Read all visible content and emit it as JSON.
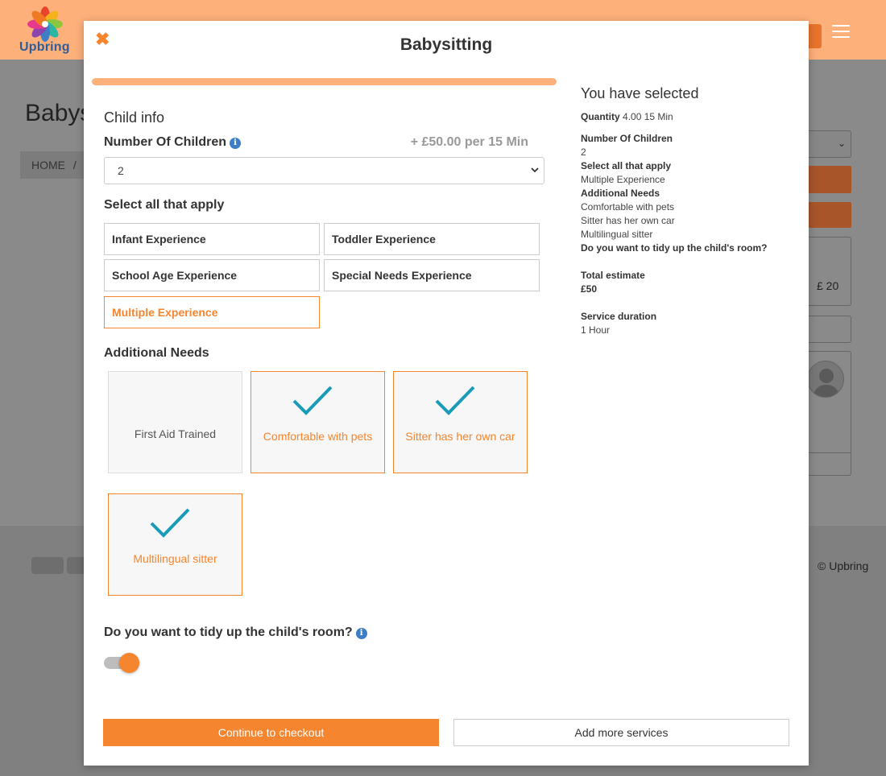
{
  "background": {
    "logo_text": "Upbring",
    "page_title": "Babys",
    "breadcrumb_home": "HOME",
    "breadcrumb_sep": "/",
    "price": "£ 20",
    "copyright": "© Upbring"
  },
  "modal": {
    "title": "Babysitting",
    "progress": 1.0,
    "section_heading": "Child info",
    "children": {
      "label": "Number Of Children",
      "price_note": "+ £50.00 per 15 Min",
      "value": "2"
    },
    "apply": {
      "heading": "Select all that apply",
      "options": [
        {
          "label": "Infant Experience",
          "selected": false
        },
        {
          "label": "Toddler Experience",
          "selected": false
        },
        {
          "label": "School Age Experience",
          "selected": false
        },
        {
          "label": "Special Needs Experience",
          "selected": false
        },
        {
          "label": "Multiple Experience",
          "selected": true
        }
      ]
    },
    "needs": {
      "heading": "Additional Needs",
      "items": [
        {
          "label": "First Aid Trained",
          "selected": false
        },
        {
          "label": "Comfortable with pets",
          "selected": true
        },
        {
          "label": "Sitter has her own car",
          "selected": true
        },
        {
          "label": "Multilingual sitter",
          "selected": true
        }
      ]
    },
    "tidy": {
      "label": "Do you want to tidy up the child's room?",
      "on": true
    },
    "buttons": {
      "checkout": "Continue to checkout",
      "more": "Add more services"
    },
    "summary": {
      "title": "You have selected",
      "quantity_label": "Quantity",
      "quantity_value": "4.00 15 Min",
      "children_label": "Number Of Children",
      "children_value": "2",
      "apply_label": "Select all that apply",
      "apply_value": "Multiple Experience",
      "needs_label": "Additional Needs",
      "needs_values": [
        "Comfortable with pets",
        "Sitter has her own car",
        "Multilingual sitter"
      ],
      "tidy_label": "Do you want to tidy up the child's room?",
      "estimate_label": "Total estimate",
      "estimate_value": "£50",
      "duration_label": "Service duration",
      "duration_value": "1 Hour"
    }
  },
  "colors": {
    "accent": "#f5852f",
    "header_bg": "#fdb07a",
    "check": "#1a9bb8",
    "info": "#3c7fc5"
  }
}
